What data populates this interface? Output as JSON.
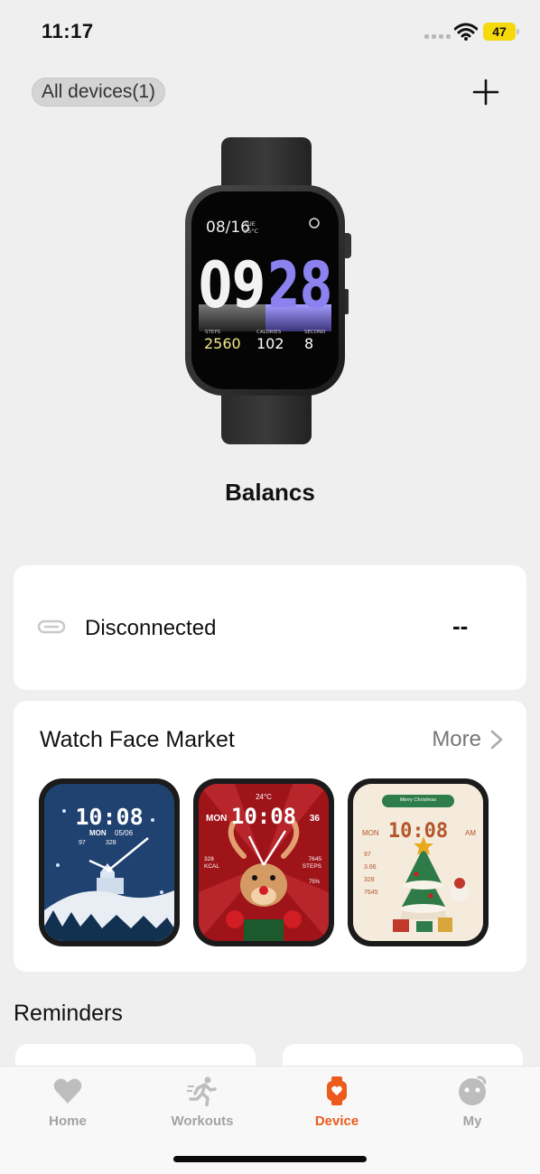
{
  "status_bar": {
    "time": "11:17",
    "battery": "47"
  },
  "header": {
    "all_devices_label": "All devices(1)"
  },
  "watch": {
    "date": "08/16",
    "weekday": "TUE",
    "temperature": "25°C",
    "hour": "09",
    "minute": "28",
    "stats": [
      {
        "label": "STEPS",
        "value": "2560"
      },
      {
        "label": "CALORIES",
        "value": "102"
      },
      {
        "label": "SECOND",
        "value": "8"
      }
    ]
  },
  "device": {
    "name": "Balancs"
  },
  "connection": {
    "label": "Disconnected",
    "value": "--"
  },
  "market": {
    "title": "Watch Face Market",
    "more_label": "More",
    "faces": [
      {
        "time": "10:08",
        "weekday": "MON",
        "date": "05/06",
        "heart": "97",
        "steps": "328"
      },
      {
        "time": "10:08",
        "weekday": "MON",
        "day": "36",
        "temp": "24°C",
        "kcal_value": "328",
        "kcal_label": "KCAL",
        "steps_value": "7645",
        "steps_label": "STEPS",
        "percent": "75%"
      },
      {
        "time": "10:08",
        "weekday": "MON",
        "ampm": "AM",
        "banner": "Merry Christmas",
        "stats": [
          "97",
          "3.66",
          "328",
          "7645"
        ]
      }
    ]
  },
  "reminders": {
    "title": "Reminders"
  },
  "tabs": [
    {
      "label": "Home",
      "icon": "heart-icon",
      "active": false
    },
    {
      "label": "Workouts",
      "icon": "runner-icon",
      "active": false
    },
    {
      "label": "Device",
      "icon": "watch-icon",
      "active": true
    },
    {
      "label": "My",
      "icon": "face-icon",
      "active": false
    }
  ],
  "colors": {
    "accent": "#ec5a1c",
    "background": "#efefef",
    "card": "#ffffff",
    "battery": "#f5d90a",
    "watch_minute": "#8b82f0",
    "tab_inactive": "#a3a3a3"
  }
}
